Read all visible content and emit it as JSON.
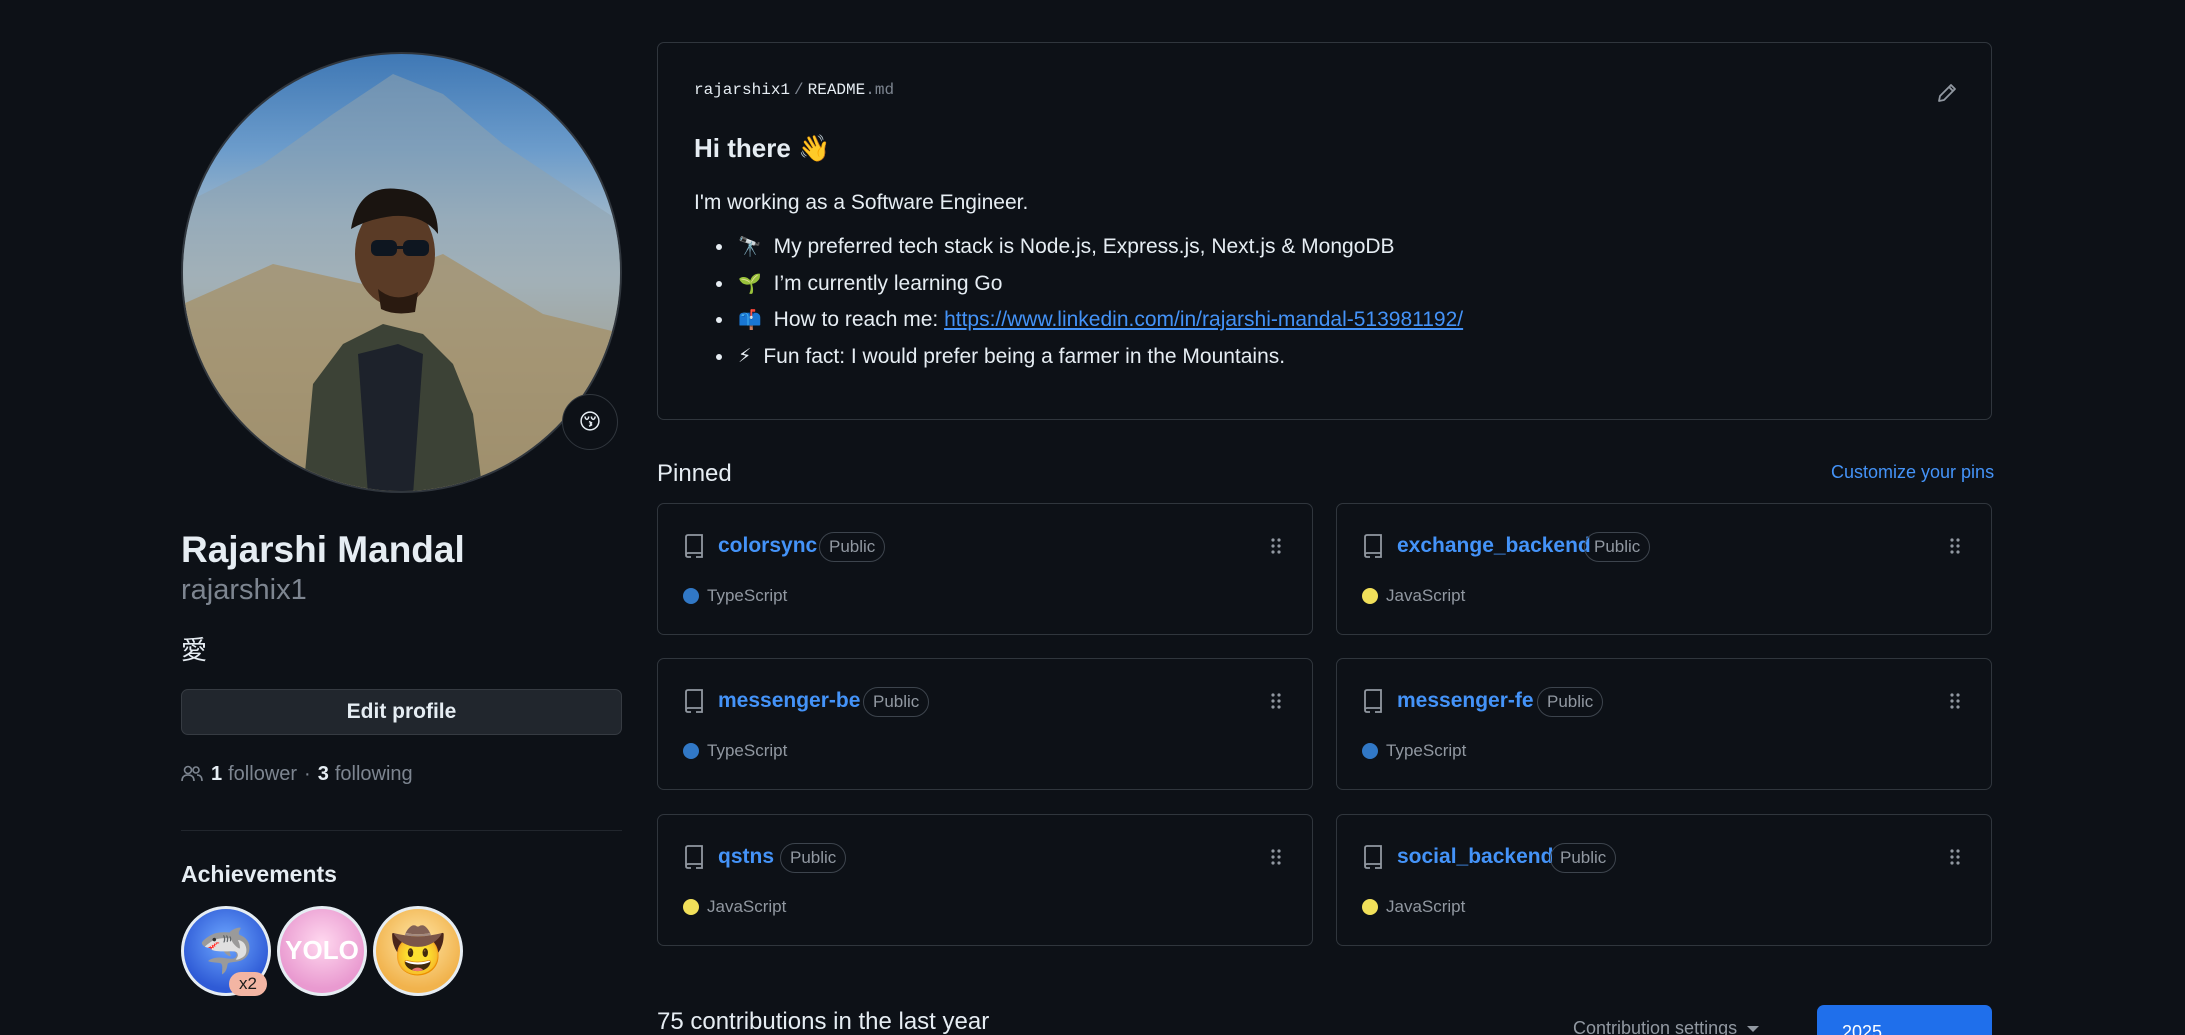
{
  "profile": {
    "full_name": "Rajarshi Mandal",
    "username": "rajarshix1",
    "bio": "愛",
    "status_emoji": "😚",
    "edit_label": "Edit profile",
    "followers_count": "1",
    "followers_label": "follower",
    "separator": "·",
    "following_count": "3",
    "following_label": "following"
  },
  "achievements": {
    "title": "Achievements",
    "badges": [
      {
        "name": "Pull Shark",
        "icon": "🦈",
        "count": "x2"
      },
      {
        "name": "YOLO",
        "icon": "YOLO"
      },
      {
        "name": "Quickdraw",
        "icon": "🤠"
      }
    ]
  },
  "readme": {
    "owner": "rajarshix1",
    "slash": "/",
    "file": "README",
    "ext": ".md",
    "heading": "Hi there 👋",
    "intro": "I'm working as a Software Engineer.",
    "items": [
      {
        "emoji": "🔭",
        "text": "My preferred tech stack is Node.js, Express.js, Next.js & MongoDB"
      },
      {
        "emoji": "🌱",
        "text": "I’m currently learning Go"
      },
      {
        "emoji": "📫",
        "text": "How to reach me: ",
        "link": "https://www.linkedin.com/in/rajarshi-mandal-513981192/"
      },
      {
        "emoji": "⚡",
        "text": "Fun fact: I would prefer being a farmer in the Mountains."
      }
    ]
  },
  "pinned": {
    "title": "Pinned",
    "customize_label": "Customize your pins",
    "repos": [
      {
        "name": "colorsync",
        "visibility": "Public",
        "language": "TypeScript",
        "lang_color": "#3178c6"
      },
      {
        "name": "exchange_backend",
        "visibility": "Public",
        "language": "JavaScript",
        "lang_color": "#f1e05a"
      },
      {
        "name": "messenger-be",
        "visibility": "Public",
        "language": "TypeScript",
        "lang_color": "#3178c6"
      },
      {
        "name": "messenger-fe",
        "visibility": "Public",
        "language": "TypeScript",
        "lang_color": "#3178c6"
      },
      {
        "name": "qstns",
        "visibility": "Public",
        "language": "JavaScript",
        "lang_color": "#f1e05a"
      },
      {
        "name": "social_backend",
        "visibility": "Public",
        "language": "JavaScript",
        "lang_color": "#f1e05a"
      }
    ]
  },
  "contributions": {
    "title": "75 contributions in the last year",
    "settings_label": "Contribution settings",
    "year": "2025"
  },
  "colors": {
    "background": "#0d1117",
    "border": "#30363d",
    "link": "#4493f8",
    "accent_button": "#1f6feb",
    "muted": "#7d8590"
  }
}
